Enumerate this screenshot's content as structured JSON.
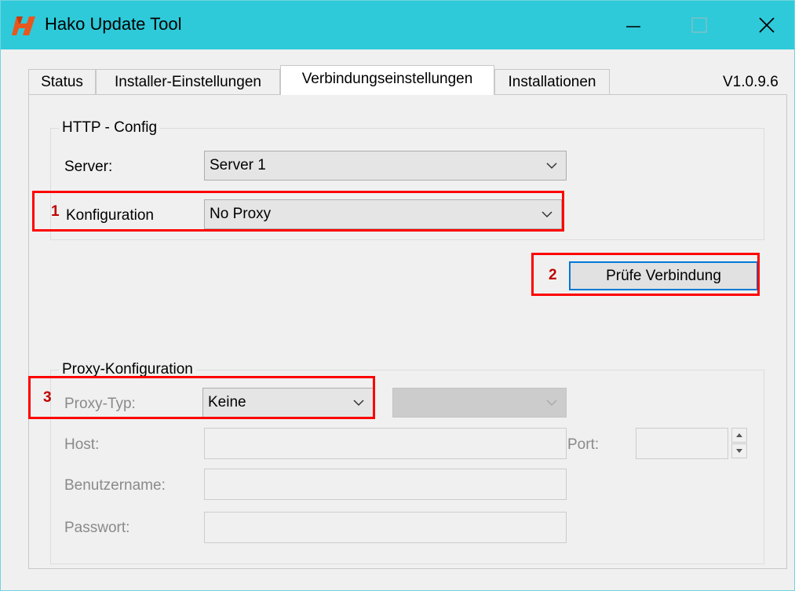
{
  "window": {
    "title": "Hako Update Tool",
    "accent_color": "#2ecad9",
    "logo": "hako-h-logo",
    "controls": [
      "minimize-icon",
      "maximize-icon",
      "close-icon"
    ]
  },
  "tabs": [
    {
      "label": "Status",
      "active": false
    },
    {
      "label": "Installer-Einstellungen",
      "active": false
    },
    {
      "label": "Verbindungseinstellungen",
      "active": true
    },
    {
      "label": "Installationen",
      "active": false
    }
  ],
  "version": "V1.0.9.6",
  "http_config": {
    "title": "HTTP - Config",
    "server_label": "Server:",
    "server_value": "Server 1",
    "konfiguration_label": "Konfiguration",
    "konfiguration_value": "No Proxy",
    "test_button": "Prüfe Verbindung"
  },
  "proxy_config": {
    "title": "Proxy-Konfiguration",
    "type_label": "Proxy-Typ:",
    "type_value": "Keine",
    "secondary_value": "",
    "host_label": "Host:",
    "host_value": "",
    "port_label": "Port:",
    "port_value": "",
    "user_label": "Benutzername:",
    "user_value": "",
    "password_label": "Passwort:",
    "password_value": ""
  },
  "annotations": {
    "marker_1": "1",
    "marker_2": "2",
    "marker_3": "3",
    "highlight_color": "#ff0000"
  }
}
